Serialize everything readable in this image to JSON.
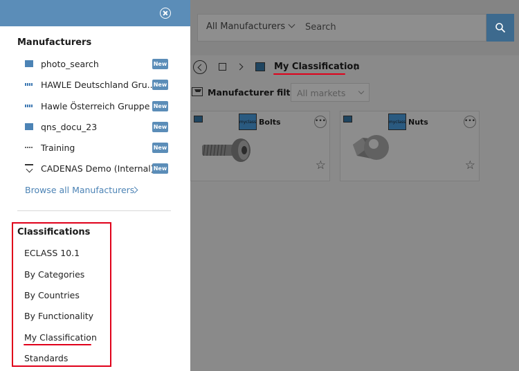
{
  "header": {
    "manufacturer_select": "All Manufacturers",
    "search_placeholder": "Search"
  },
  "breadcrumb": {
    "current": "My Classification"
  },
  "filter": {
    "label": "Manufacturer filter",
    "markets_value": "All markets"
  },
  "cards": [
    {
      "title": "Bolts",
      "logo_text": "myclass",
      "icon": "bolt-image"
    },
    {
      "title": "Nuts",
      "logo_text": "myclass",
      "icon": "nut-image"
    }
  ],
  "panel": {
    "manufacturers_heading": "Manufacturers",
    "manufacturers": [
      {
        "label": "photo_search",
        "badge": "New",
        "logo": "folder-icon"
      },
      {
        "label": "HAWLE Deutschland Gru...",
        "badge": "New",
        "logo": "hawle-logo"
      },
      {
        "label": "Hawle Österreich Gruppe",
        "badge": "New",
        "logo": "hawle-logo"
      },
      {
        "label": "qns_docu_23",
        "badge": "New",
        "logo": "folder-icon"
      },
      {
        "label": "Training",
        "badge": "New",
        "logo": "training-logo"
      },
      {
        "label": "CADENAS Demo (Internal)",
        "badge": "New",
        "logo": "cadenas-logo"
      }
    ],
    "browse_all": "Browse all Manufacturers",
    "classifications_heading": "Classifications",
    "classifications": [
      "ECLASS 10.1",
      "By Categories",
      "By Countries",
      "By Functionality",
      "My Classification",
      "Standards"
    ]
  },
  "colors": {
    "panel_header": "#5b8db8",
    "badge": "#5b8db8",
    "link": "#4c83b5",
    "highlight": "#e0001a",
    "search_button": "#3d6a8e"
  }
}
